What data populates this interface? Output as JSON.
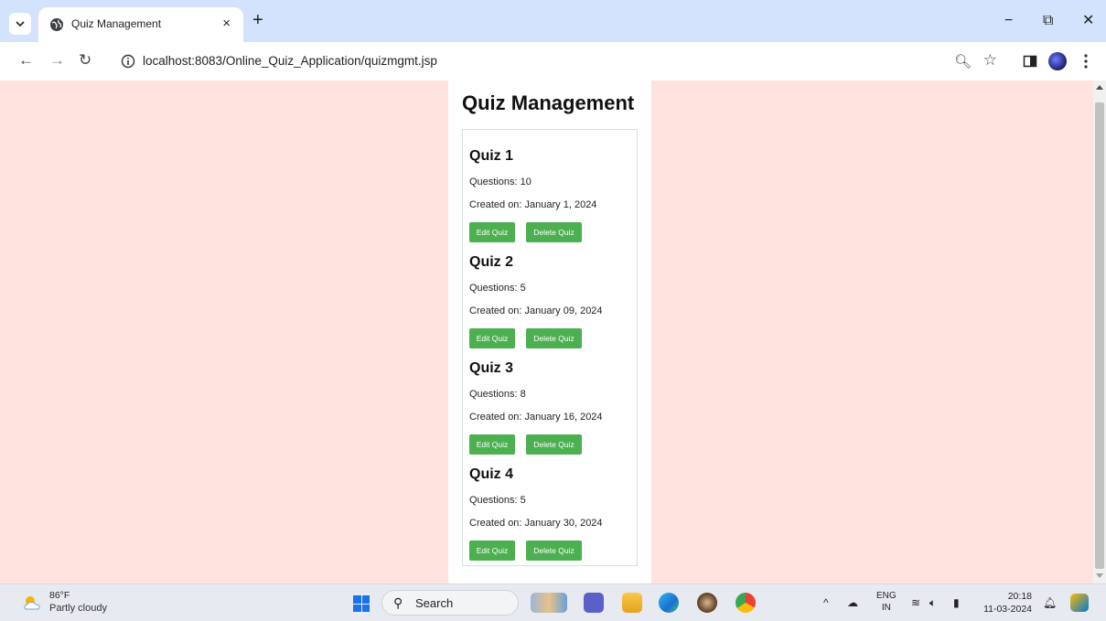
{
  "browser": {
    "tab": {
      "title": "Quiz Management",
      "close_glyph": "×"
    },
    "new_tab_glyph": "+",
    "window": {
      "minimize_glyph": "−",
      "restore_glyph": "⧉",
      "close_glyph": "✕"
    },
    "url": "localhost:8083/Online_Quiz_Application/quizmgmt.jsp",
    "icons": [
      "tab-menu-icon",
      "globe-icon",
      "back-icon",
      "forward-icon",
      "reload-icon",
      "info-icon",
      "zoom-icon",
      "star-icon",
      "side-panel-icon",
      "profile-avatar",
      "more-icon"
    ]
  },
  "page": {
    "title": "Quiz Management",
    "quizzes": [
      {
        "name": "Quiz 1",
        "questions": "Questions: 10",
        "created": "Created on: January 1, 2024",
        "edit_label": "Edit Quiz",
        "delete_label": "Delete Quiz"
      },
      {
        "name": "Quiz 2",
        "questions": "Questions: 5",
        "created": "Created on: January 09, 2024",
        "edit_label": "Edit Quiz",
        "delete_label": "Delete Quiz"
      },
      {
        "name": "Quiz 3",
        "questions": "Questions: 8",
        "created": "Created on: January 16, 2024",
        "edit_label": "Edit Quiz",
        "delete_label": "Delete Quiz"
      },
      {
        "name": "Quiz 4",
        "questions": "Questions: 5",
        "created": "Created on: January 30, 2024",
        "edit_label": "Edit Quiz",
        "delete_label": "Delete Quiz"
      }
    ],
    "colors": {
      "background": "#ffe3de",
      "button": "#4caf50"
    }
  },
  "taskbar": {
    "weather": {
      "temp": "86°F",
      "desc": "Partly cloudy"
    },
    "search_label": "Search",
    "language": {
      "line1": "ENG",
      "line2": "IN"
    },
    "clock": {
      "time": "20:18",
      "date": "11-03-2024"
    }
  }
}
